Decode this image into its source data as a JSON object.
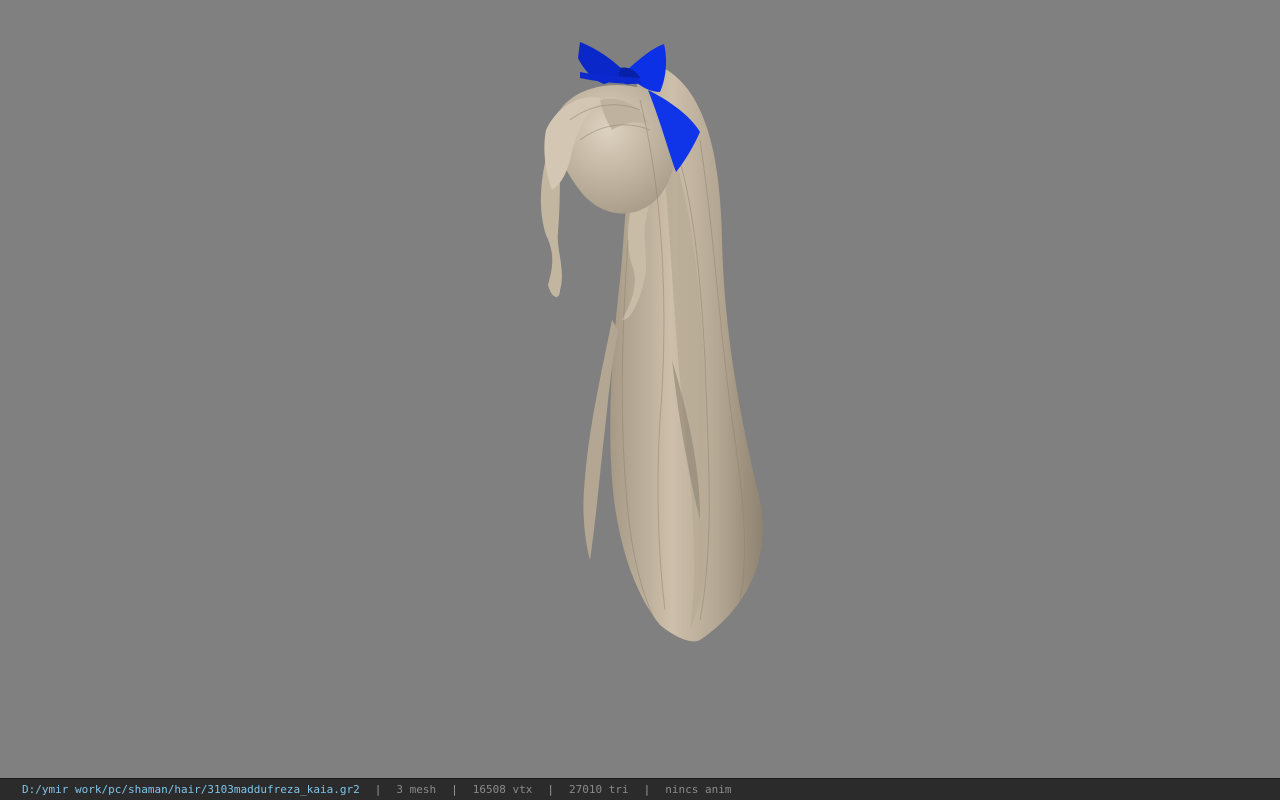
{
  "viewport": {
    "background": "#808080",
    "model": {
      "description_icon": "hair-model-render",
      "hair_color": "#cbbfab",
      "bow_color": "#0a2be0"
    }
  },
  "status_bar": {
    "file_path": "D:/ymir work/pc/shaman/hair/3103maddufreza_kaia.gr2",
    "separator": "|",
    "mesh_count": "3 mesh",
    "vertex_count": "16508 vtx",
    "triangle_count": "27010 tri",
    "anim_status": "nincs anim"
  }
}
